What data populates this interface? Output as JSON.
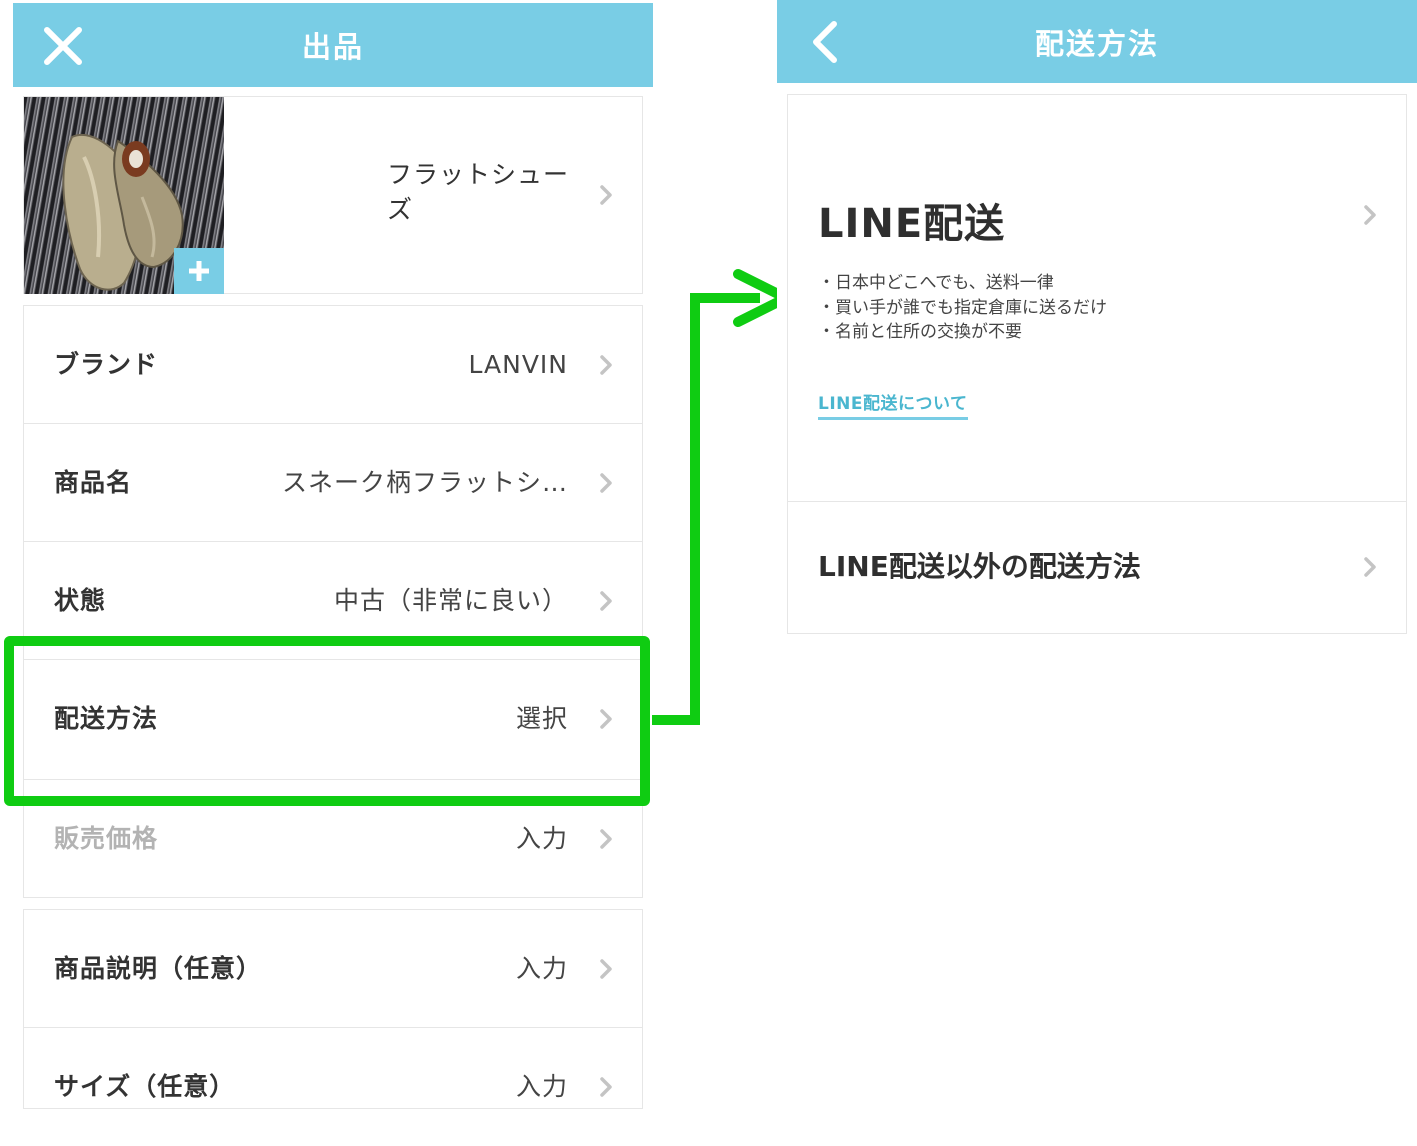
{
  "colors": {
    "appbar": "#79cde5",
    "highlight": "#0fcc12",
    "link": "#4ab6cf"
  },
  "left_screen": {
    "title": "出品",
    "close_icon": "close-icon",
    "photo": {
      "alt": "metallic flat shoes on striped fabric",
      "add_icon": "plus-icon"
    },
    "category": "フラットシューズ",
    "rows": [
      {
        "label": "ブランド",
        "value": "LANVIN"
      },
      {
        "label": "商品名",
        "value": "スネーク柄フラットシ…"
      },
      {
        "label": "状態",
        "value": "中古（非常に良い）"
      },
      {
        "label": "配送方法",
        "value": "選択"
      },
      {
        "label": "販売価格",
        "value": "入力"
      }
    ],
    "optional_rows": [
      {
        "label": "商品説明（任意）",
        "value": "入力"
      },
      {
        "label": "サイズ（任意）",
        "value": "入力"
      }
    ]
  },
  "right_screen": {
    "title": "配送方法",
    "back_icon": "chevron-left-icon",
    "line_delivery": {
      "title": "LINE配送",
      "bullets": [
        "・日本中どこへでも、送料一律",
        "・買い手が誰でも指定倉庫に送るだけ",
        "・名前と住所の交換が不要"
      ],
      "link": "LINE配送について"
    },
    "other_delivery": "LINE配送以外の配送方法"
  }
}
